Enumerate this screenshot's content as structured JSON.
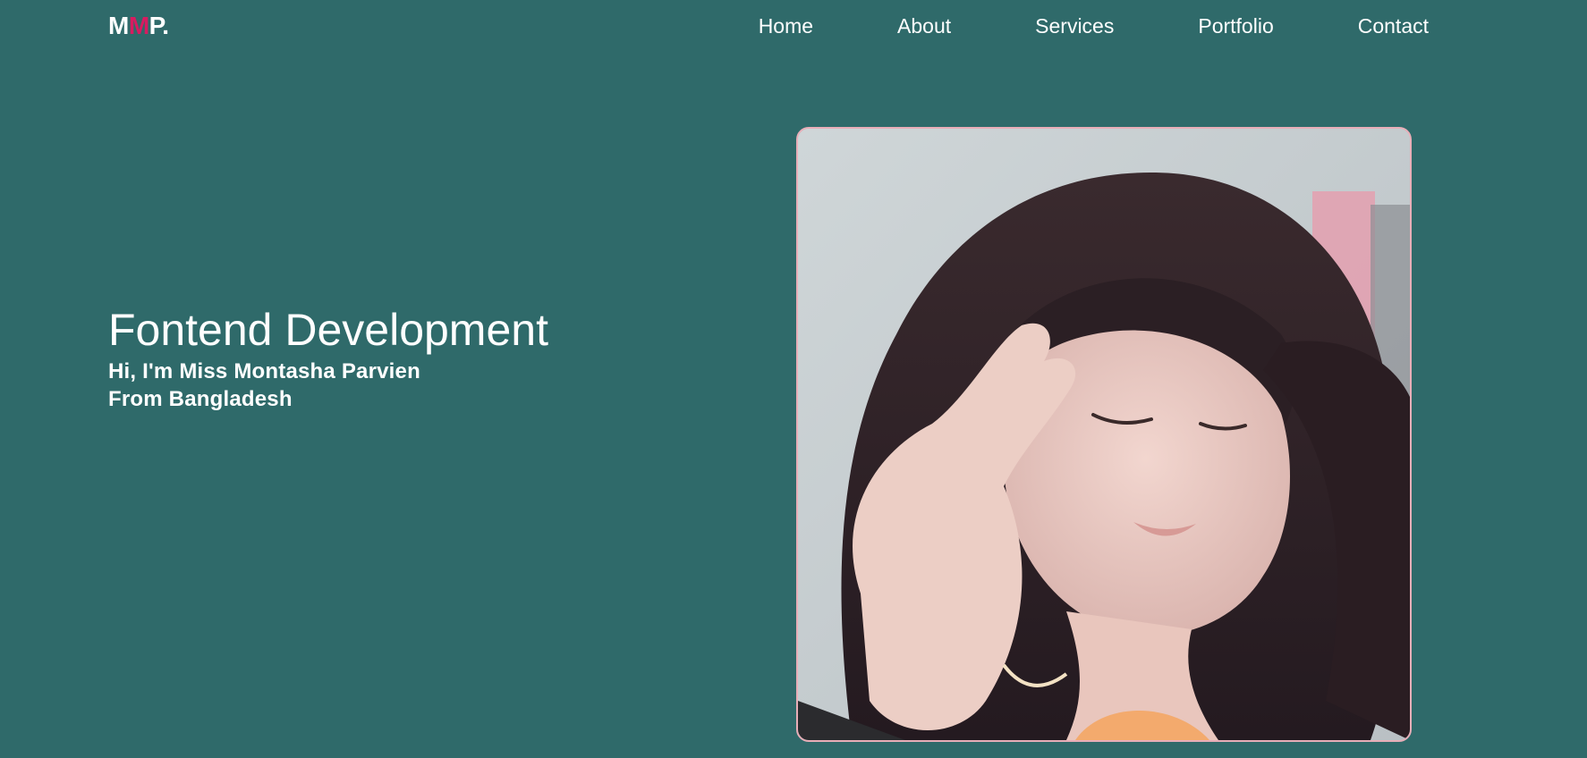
{
  "brand": {
    "logo_part1": "M",
    "logo_part2": "M",
    "logo_part3": "P.",
    "accent_color": "#d81b60"
  },
  "nav": {
    "items": [
      {
        "label": "Home"
      },
      {
        "label": "About"
      },
      {
        "label": "Services"
      },
      {
        "label": "Portfolio"
      },
      {
        "label": "Contact"
      }
    ]
  },
  "hero": {
    "title": "Fontend Development",
    "subtitle_line1": "Hi, I'm Miss Montasha Parvien",
    "subtitle_line2": "From Bangladesh"
  },
  "colors": {
    "background": "#2f6a6a",
    "photo_border": "#e8aeb8"
  },
  "photo": {
    "icon": "profile-photo"
  }
}
